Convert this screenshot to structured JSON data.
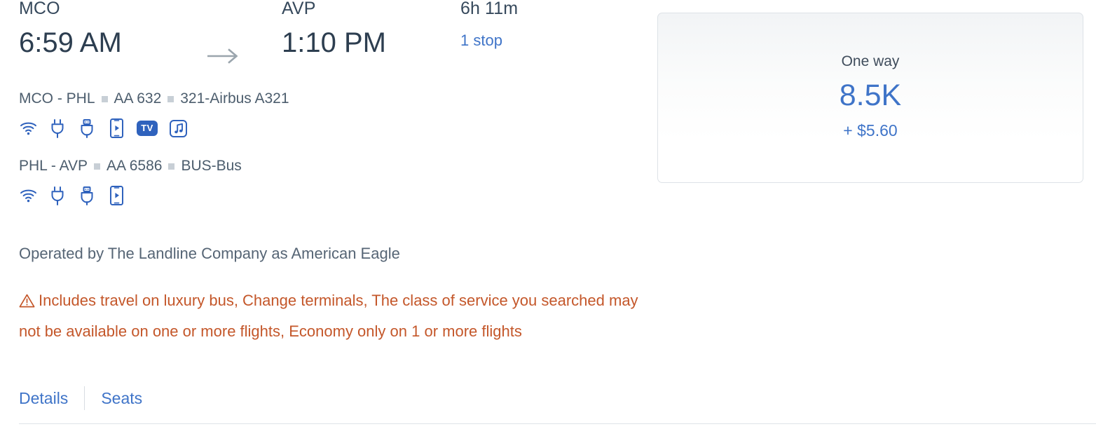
{
  "flight": {
    "origin": {
      "code": "MCO",
      "time": "6:59 AM"
    },
    "destination": {
      "code": "AVP",
      "time": "1:10 PM"
    },
    "duration": "6h 11m",
    "stops_label": "1 stop",
    "arrow_icon": "arrow-right-icon",
    "legs": [
      {
        "route": "MCO - PHL",
        "flight_number": "AA 632",
        "aircraft": "321-Airbus A321",
        "amenities": [
          "wifi-icon",
          "power-outlet-icon",
          "usb-port-icon",
          "device-streaming-icon",
          "tv-icon",
          "music-icon"
        ],
        "tv_label": "TV"
      },
      {
        "route": "PHL - AVP",
        "flight_number": "AA 6586",
        "aircraft": "BUS-Bus",
        "amenities": [
          "wifi-icon",
          "power-outlet-icon",
          "usb-port-icon",
          "device-streaming-icon"
        ]
      }
    ],
    "operated_by": "Operated by The Landline Company as American Eagle",
    "warning": {
      "icon": "warning-triangle-icon",
      "text": "Includes travel on luxury bus, Change terminals, The class of service you searched may not be available on one or more flights, Economy only on 1 or more flights"
    }
  },
  "actions": {
    "details_label": "Details",
    "seats_label": "Seats"
  },
  "price": {
    "fare_type": "One way",
    "amount": "8.5K",
    "taxes": "+ $5.60"
  },
  "colors": {
    "link": "#3f74c8",
    "icon_blue": "#2f62bd",
    "warning": "#c4572a",
    "text_dark": "#2d3e50",
    "text_muted": "#566575",
    "separator": "#c8cfd6",
    "border": "#dde2e7"
  }
}
